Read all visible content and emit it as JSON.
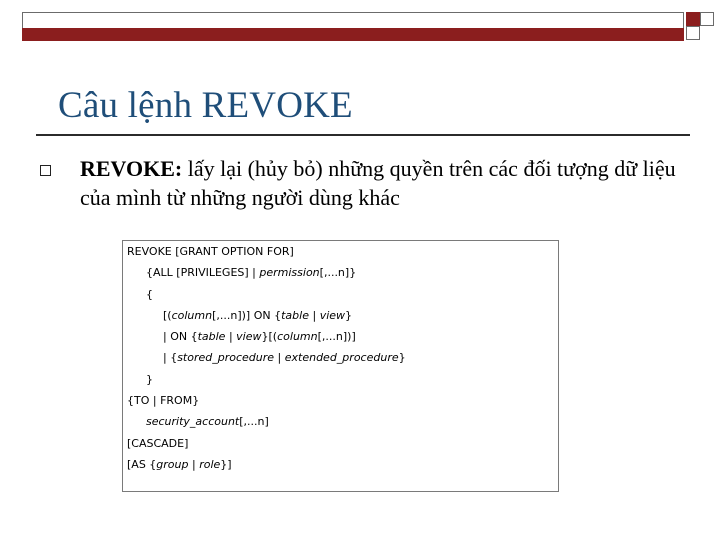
{
  "slide": {
    "title": "Câu lệnh REVOKE",
    "bullet_label": "REVOKE:",
    "bullet_text": " lấy lại (hủy bỏ) những quyền trên các đối tượng dữ liệu của mình từ những người dùng khác"
  },
  "syntax": {
    "l1": "REVOKE [GRANT OPTION FOR]",
    "l2a": "{ALL [PRIVILEGES] | ",
    "l2b": "permission",
    "l2c": "[,...n]}",
    "l3": "{",
    "l4a": "[(",
    "l4b": "column",
    "l4c": "[,...n])] ON {",
    "l4d": "table",
    "l4e": " | ",
    "l4f": "view",
    "l4g": "}",
    "l5a": "| ON {",
    "l5b": "table",
    "l5c": " | ",
    "l5d": "view",
    "l5e": "}[(",
    "l5f": "column",
    "l5g": "[,...n])]",
    "l6a": "| {",
    "l6b": "stored_procedure",
    "l6c": " | ",
    "l6d": "extended_procedure",
    "l6e": "}",
    "l7": "}",
    "l8": "{TO | FROM}",
    "l9a": "security_account",
    "l9b": "[,...n]",
    "l10": "[CASCADE]",
    "l11a": "[AS {",
    "l11b": "group",
    "l11c": " | ",
    "l11d": "role",
    "l11e": "}]"
  },
  "colors": {
    "title": "#1f4e79",
    "accent": "#8b1e1e"
  }
}
